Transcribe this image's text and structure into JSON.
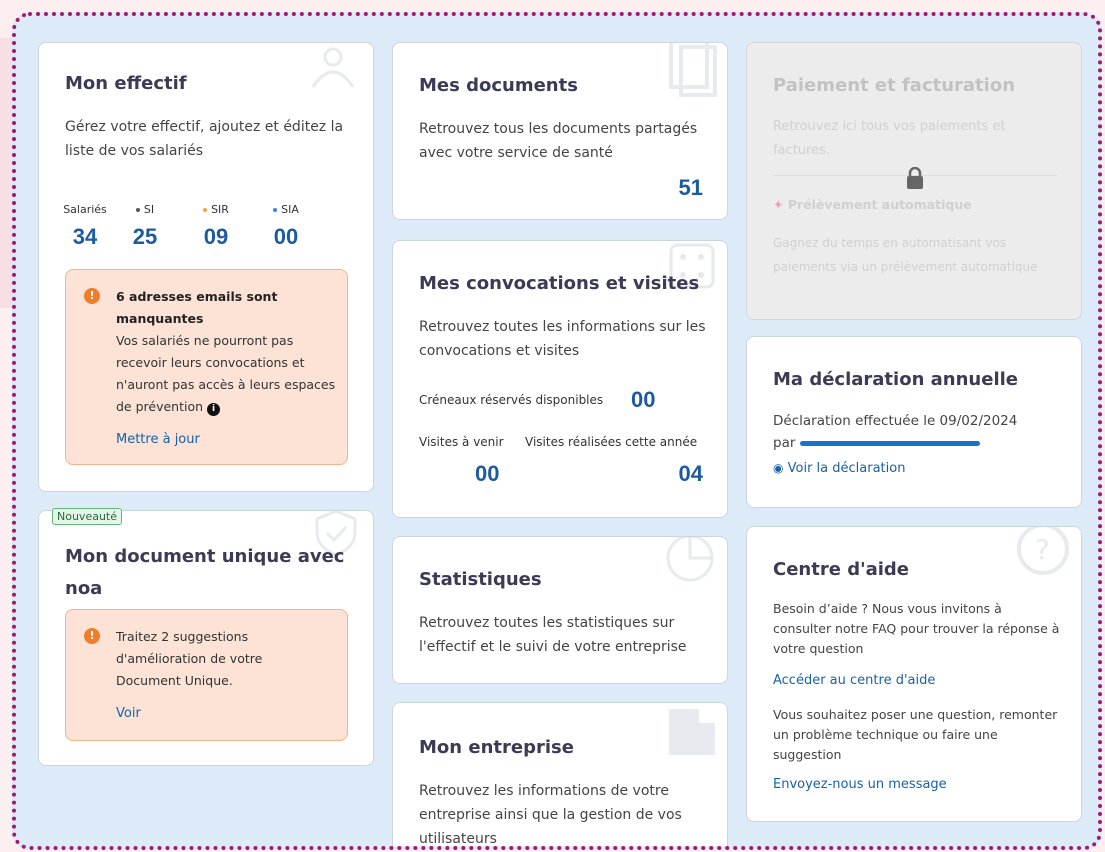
{
  "effectif": {
    "title": "Mon effectif",
    "desc": "Gérez votre effectif, ajoutez et éditez la liste de vos salariés",
    "stats": [
      {
        "label": "Salariés",
        "value": "34",
        "dot_color": ""
      },
      {
        "label": "SI",
        "value": "25",
        "dot_color": "#555555"
      },
      {
        "label": "SIR",
        "value": "09",
        "dot_color": "#f0a23c"
      },
      {
        "label": "SIA",
        "value": "00",
        "dot_color": "#3a87d6"
      }
    ],
    "alert": {
      "title": "6 adresses emails sont manquantes",
      "body": "Vos salariés ne pourront pas recevoir leurs convocations et n'auront pas accès à leurs espaces de prévention",
      "link": "Mettre à jour"
    }
  },
  "document_unique": {
    "badge": "Nouveauté",
    "title": "Mon document unique avec noa",
    "alert": {
      "body": "Traitez 2 suggestions d'amélioration de votre Document Unique.",
      "link": "Voir"
    }
  },
  "documents": {
    "title": "Mes documents",
    "desc": "Retrouvez tous les documents partagés avec votre service de santé",
    "count": "51"
  },
  "convocations": {
    "title": "Mes convocations et visites",
    "desc": "Retrouvez toutes les informations sur les convocations et visites",
    "slots_label": "Créneaux réservés disponibles",
    "slots_value": "00",
    "upcoming_label": "Visites à venir",
    "upcoming_value": "00",
    "done_label": "Visites réalisées cette année",
    "done_value": "04"
  },
  "statistiques": {
    "title": "Statistiques",
    "desc": "Retrouvez toutes les statistiques sur l'effectif et le suivi de votre entreprise"
  },
  "entreprise": {
    "title": "Mon entreprise",
    "desc": "Retrouvez les informations de votre entreprise ainsi que la gestion de vos utilisateurs"
  },
  "paiement": {
    "title": "Paiement et facturation",
    "desc": "Retrouvez ici tous vos paiements et factures.",
    "sub_title": "Prélèvement automatique",
    "sub_desc": "Gagnez du temps en automatisant vos paiements via un prélèvement automatique"
  },
  "declaration": {
    "title": "Ma déclaration annuelle",
    "line1": "Déclaration effectuée le 09/02/2024",
    "line2_prefix": "par",
    "link": "Voir la déclaration"
  },
  "aide": {
    "title": "Centre d'aide",
    "desc": "Besoin d’aide ? Nous vous invitons à consulter notre FAQ pour trouver la réponse à votre question",
    "link1": "Accéder au centre d'aide",
    "desc2": "Vous souhaitez poser une question, remonter un problème technique ou faire une suggestion",
    "link2": "Envoyez-nous un message"
  }
}
